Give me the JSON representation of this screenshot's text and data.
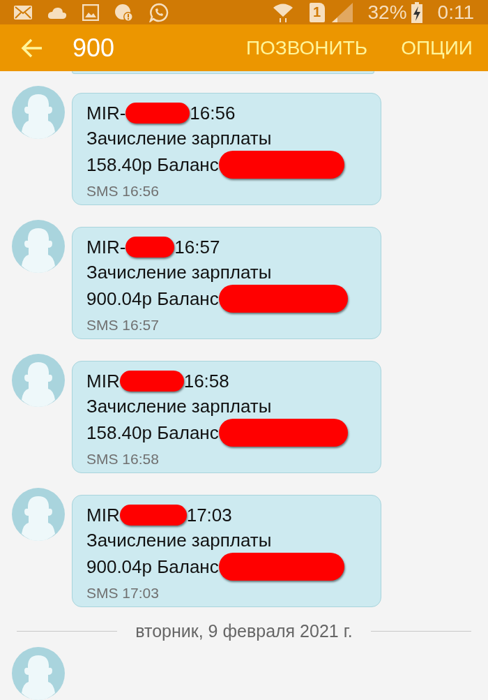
{
  "status_bar": {
    "sim_label": "1",
    "battery": "32%",
    "time": "0:11"
  },
  "app_bar": {
    "title": "900",
    "actions": [
      "ПОЗВОНИТЬ",
      "ОПЦИИ"
    ]
  },
  "messages": [
    {
      "sender_prefix": "MIR-",
      "sender_time": "16:56",
      "body": "Зачисление зарплаты",
      "amount_line": "158.40р Баланс",
      "meta": "SMS 16:56"
    },
    {
      "sender_prefix": "MIR-",
      "sender_time": "16:57",
      "body": "Зачисление зарплаты",
      "amount_line": "900.04р Баланс",
      "meta": "SMS 16:57"
    },
    {
      "sender_prefix": "MIR",
      "sender_time": "16:58",
      "body": "Зачисление зарплаты",
      "amount_line": "158.40р Баланс",
      "meta": "SMS 16:58"
    },
    {
      "sender_prefix": "MIR",
      "sender_time": "17:03",
      "body": "Зачисление зарплаты",
      "amount_line": "900.04р Баланс",
      "meta": "SMS 17:03"
    }
  ],
  "date_separator": "вторник, 9 февраля 2021 г."
}
